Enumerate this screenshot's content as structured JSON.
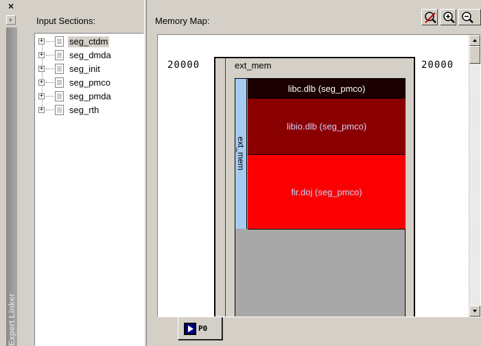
{
  "sidebar": {
    "close_glyph": "×",
    "title": "Expert Linker"
  },
  "input_sections": {
    "heading": "Input Sections:",
    "items": [
      {
        "label": "seg_ctdm",
        "expander": "+",
        "icon": "document-icon"
      },
      {
        "label": "seg_dmda",
        "expander": "+",
        "icon": "document-icon"
      },
      {
        "label": "seg_init",
        "expander": "+",
        "icon": "document-icon"
      },
      {
        "label": "seg_pmco",
        "expander": "+",
        "icon": "document-icon"
      },
      {
        "label": "seg_pmda",
        "expander": "+",
        "icon": "document-icon"
      },
      {
        "label": "seg_rth",
        "expander": "+",
        "icon": "document-icon"
      }
    ]
  },
  "memory_map": {
    "heading": "Memory Map:",
    "toolbar": [
      "zoom-reset-icon",
      "zoom-in-icon",
      "zoom-out-icon"
    ],
    "start_address_left": "20000",
    "start_address_right": "20000",
    "memory_name": "ext_mem",
    "side_label": "ext_mem",
    "segments": [
      {
        "label": "libc.dlb (seg_pmco)",
        "color": "#1a0000"
      },
      {
        "label": "libio.dlb (seg_pmco)",
        "color": "#8a0000"
      },
      {
        "label": "fir.doj (seg_pmco)",
        "color": "#fa0000"
      }
    ],
    "unused_color": "#a8a8a8"
  },
  "tabs": [
    {
      "label": "P0",
      "icon": "processor-icon",
      "active": true
    }
  ]
}
